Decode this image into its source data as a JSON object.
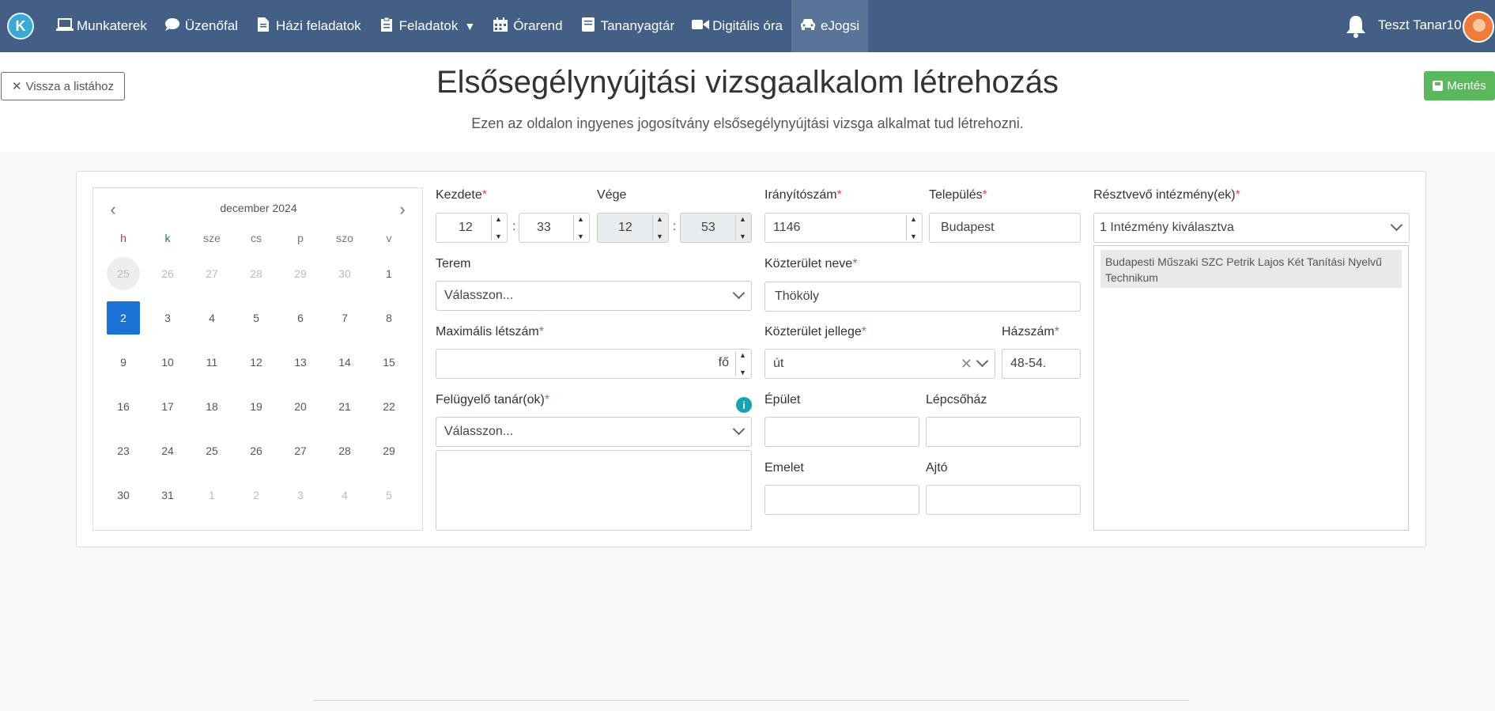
{
  "navbar": {
    "logo_letter": "K",
    "items": [
      {
        "label": "Munkaterek",
        "icon": "laptop-icon"
      },
      {
        "label": "Üzenőfal",
        "icon": "chat-icon"
      },
      {
        "label": "Házi feladatok",
        "icon": "file-icon"
      },
      {
        "label": "Feladatok",
        "icon": "clipboard-icon"
      },
      {
        "label": "Órarend",
        "icon": "calendar-icon"
      },
      {
        "label": "Tananyagtár",
        "icon": "book-icon"
      },
      {
        "label": "Digitális óra",
        "icon": "video-icon"
      },
      {
        "label": "eJogsi",
        "icon": "car-icon"
      }
    ],
    "user_name": "Teszt Tanar10"
  },
  "header": {
    "back_label": "Vissza a listához",
    "title": "Elsősegélynyújtási vizsgaalkalom létrehozás",
    "subtitle": "Ezen az oldalon ingyenes jogosítvány elsősegélynyújtási vizsga alkalmat tud létrehozni.",
    "save_label": "Mentés"
  },
  "calendar": {
    "month_label": "december 2024",
    "weekdays": [
      "h",
      "k",
      "sze",
      "cs",
      "p",
      "szo",
      "v"
    ],
    "weeks": [
      [
        {
          "d": "25",
          "s": "prevsel"
        },
        {
          "d": "26",
          "s": "muted"
        },
        {
          "d": "27",
          "s": "muted"
        },
        {
          "d": "28",
          "s": "muted"
        },
        {
          "d": "29",
          "s": "muted"
        },
        {
          "d": "30",
          "s": "muted"
        },
        {
          "d": "1",
          "s": ""
        }
      ],
      [
        {
          "d": "2",
          "s": "today"
        },
        {
          "d": "3",
          "s": ""
        },
        {
          "d": "4",
          "s": ""
        },
        {
          "d": "5",
          "s": ""
        },
        {
          "d": "6",
          "s": ""
        },
        {
          "d": "7",
          "s": ""
        },
        {
          "d": "8",
          "s": ""
        }
      ],
      [
        {
          "d": "9",
          "s": ""
        },
        {
          "d": "10",
          "s": ""
        },
        {
          "d": "11",
          "s": ""
        },
        {
          "d": "12",
          "s": ""
        },
        {
          "d": "13",
          "s": ""
        },
        {
          "d": "14",
          "s": ""
        },
        {
          "d": "15",
          "s": ""
        }
      ],
      [
        {
          "d": "16",
          "s": ""
        },
        {
          "d": "17",
          "s": ""
        },
        {
          "d": "18",
          "s": ""
        },
        {
          "d": "19",
          "s": ""
        },
        {
          "d": "20",
          "s": ""
        },
        {
          "d": "21",
          "s": ""
        },
        {
          "d": "22",
          "s": ""
        }
      ],
      [
        {
          "d": "23",
          "s": ""
        },
        {
          "d": "24",
          "s": ""
        },
        {
          "d": "25",
          "s": ""
        },
        {
          "d": "26",
          "s": ""
        },
        {
          "d": "27",
          "s": ""
        },
        {
          "d": "28",
          "s": ""
        },
        {
          "d": "29",
          "s": ""
        }
      ],
      [
        {
          "d": "30",
          "s": ""
        },
        {
          "d": "31",
          "s": ""
        },
        {
          "d": "1",
          "s": "muted"
        },
        {
          "d": "2",
          "s": "muted"
        },
        {
          "d": "3",
          "s": "muted"
        },
        {
          "d": "4",
          "s": "muted"
        },
        {
          "d": "5",
          "s": "muted"
        }
      ]
    ]
  },
  "form": {
    "start_label": "Kezdete",
    "start_hour": "12",
    "start_minute": "33",
    "end_label": "Vége",
    "end_hour": "12",
    "end_minute": "53",
    "room_label": "Terem",
    "room_placeholder": "Válasszon...",
    "max_label": "Maximális létszám",
    "max_value": "",
    "max_unit": "fő",
    "supervisor_label": "Felügyelő tanár(ok)",
    "supervisor_placeholder": "Válasszon...",
    "zip_label": "Irányítószám",
    "zip_value": "1146",
    "city_label": "Település",
    "city_value": "Budapest",
    "street_label": "Közterület neve",
    "street_value": "Thököly",
    "street_type_label": "Közterület jellege",
    "street_type_value": "út",
    "house_label": "Házszám",
    "house_value": "48-54.",
    "building_label": "Épület",
    "building_value": "",
    "stairway_label": "Lépcsőház",
    "stairway_value": "",
    "floor_label": "Emelet",
    "floor_value": "",
    "door_label": "Ajtó",
    "door_value": "",
    "institution_label": "Résztvevő intézmény(ek)",
    "institution_summary": "1 Intézmény kiválasztva",
    "institutions": [
      "Budapesti Műszaki SZC Petrik Lajos Két Tanítási Nyelvű Technikum"
    ],
    "required_mark": "*"
  }
}
